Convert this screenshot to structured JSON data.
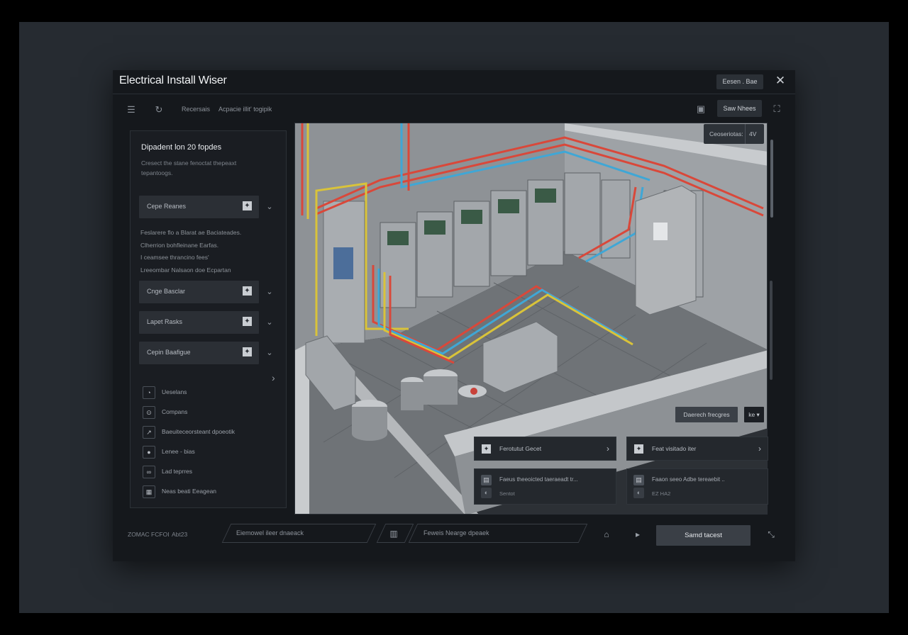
{
  "window": {
    "title": "Electrical Install Wiser",
    "title_button": "Eesen . Bae"
  },
  "toolbar": {
    "item1": "Recersais",
    "item2": "Acpacie illit' togipik",
    "right_button": "Saw Nhees"
  },
  "sidebar": {
    "title": "Dipadent lon 20 fopdes",
    "subtitle": "Cresect the stane fenoctat thepeaxt tepantoogs.",
    "dropdowns": [
      {
        "label": "Cepe Reanes"
      },
      {
        "label": "Cnge Basclar"
      },
      {
        "label": "Lapet Rasks"
      },
      {
        "label": "Cepin Baafigue"
      }
    ],
    "notes": [
      "Feslarere flo a Blarat ae Baciateades.",
      "Clherrion bohfleinane Earfas.",
      "I ceamsee  thrancino fees'",
      "Lreeombar Nalsaon doe Ecpartan"
    ],
    "tools": [
      {
        "label": "Ueselans"
      },
      {
        "label": "Compans"
      },
      {
        "label": "Baeuiteceorsteant dpoeotik"
      },
      {
        "label": "Lenee - bias"
      },
      {
        "label": "Lad teprres"
      },
      {
        "label": "Neas beati Eeagean"
      }
    ]
  },
  "viewport": {
    "chip_label": "Ceoseriotas:",
    "chip_value": "4V",
    "overlay_button": "Daerech frecgres",
    "overlay_toggle": "ke ▾",
    "cards": [
      {
        "label": "Ferotutut Gecet"
      },
      {
        "label": "Feat visitado iter"
      }
    ],
    "info": [
      {
        "line1": "Faeus theeoicted taeraeadt tr...",
        "line2": "Sentot"
      },
      {
        "line1": "Faaon seeo Adbe tereaebit ..",
        "line2": "EZ HA2"
      }
    ]
  },
  "bottombar": {
    "left_text": "ZOMAC FCFOI",
    "left_text2": "Abt23",
    "input1": "Eiemowel ileer dnaeack",
    "input2": "Feweis Nearge dpeaek",
    "primary": "Samd tacest"
  },
  "colors": {
    "wire_red": "#d9483a",
    "wire_blue": "#3fa7d6",
    "wire_yellow": "#d9c33a"
  }
}
